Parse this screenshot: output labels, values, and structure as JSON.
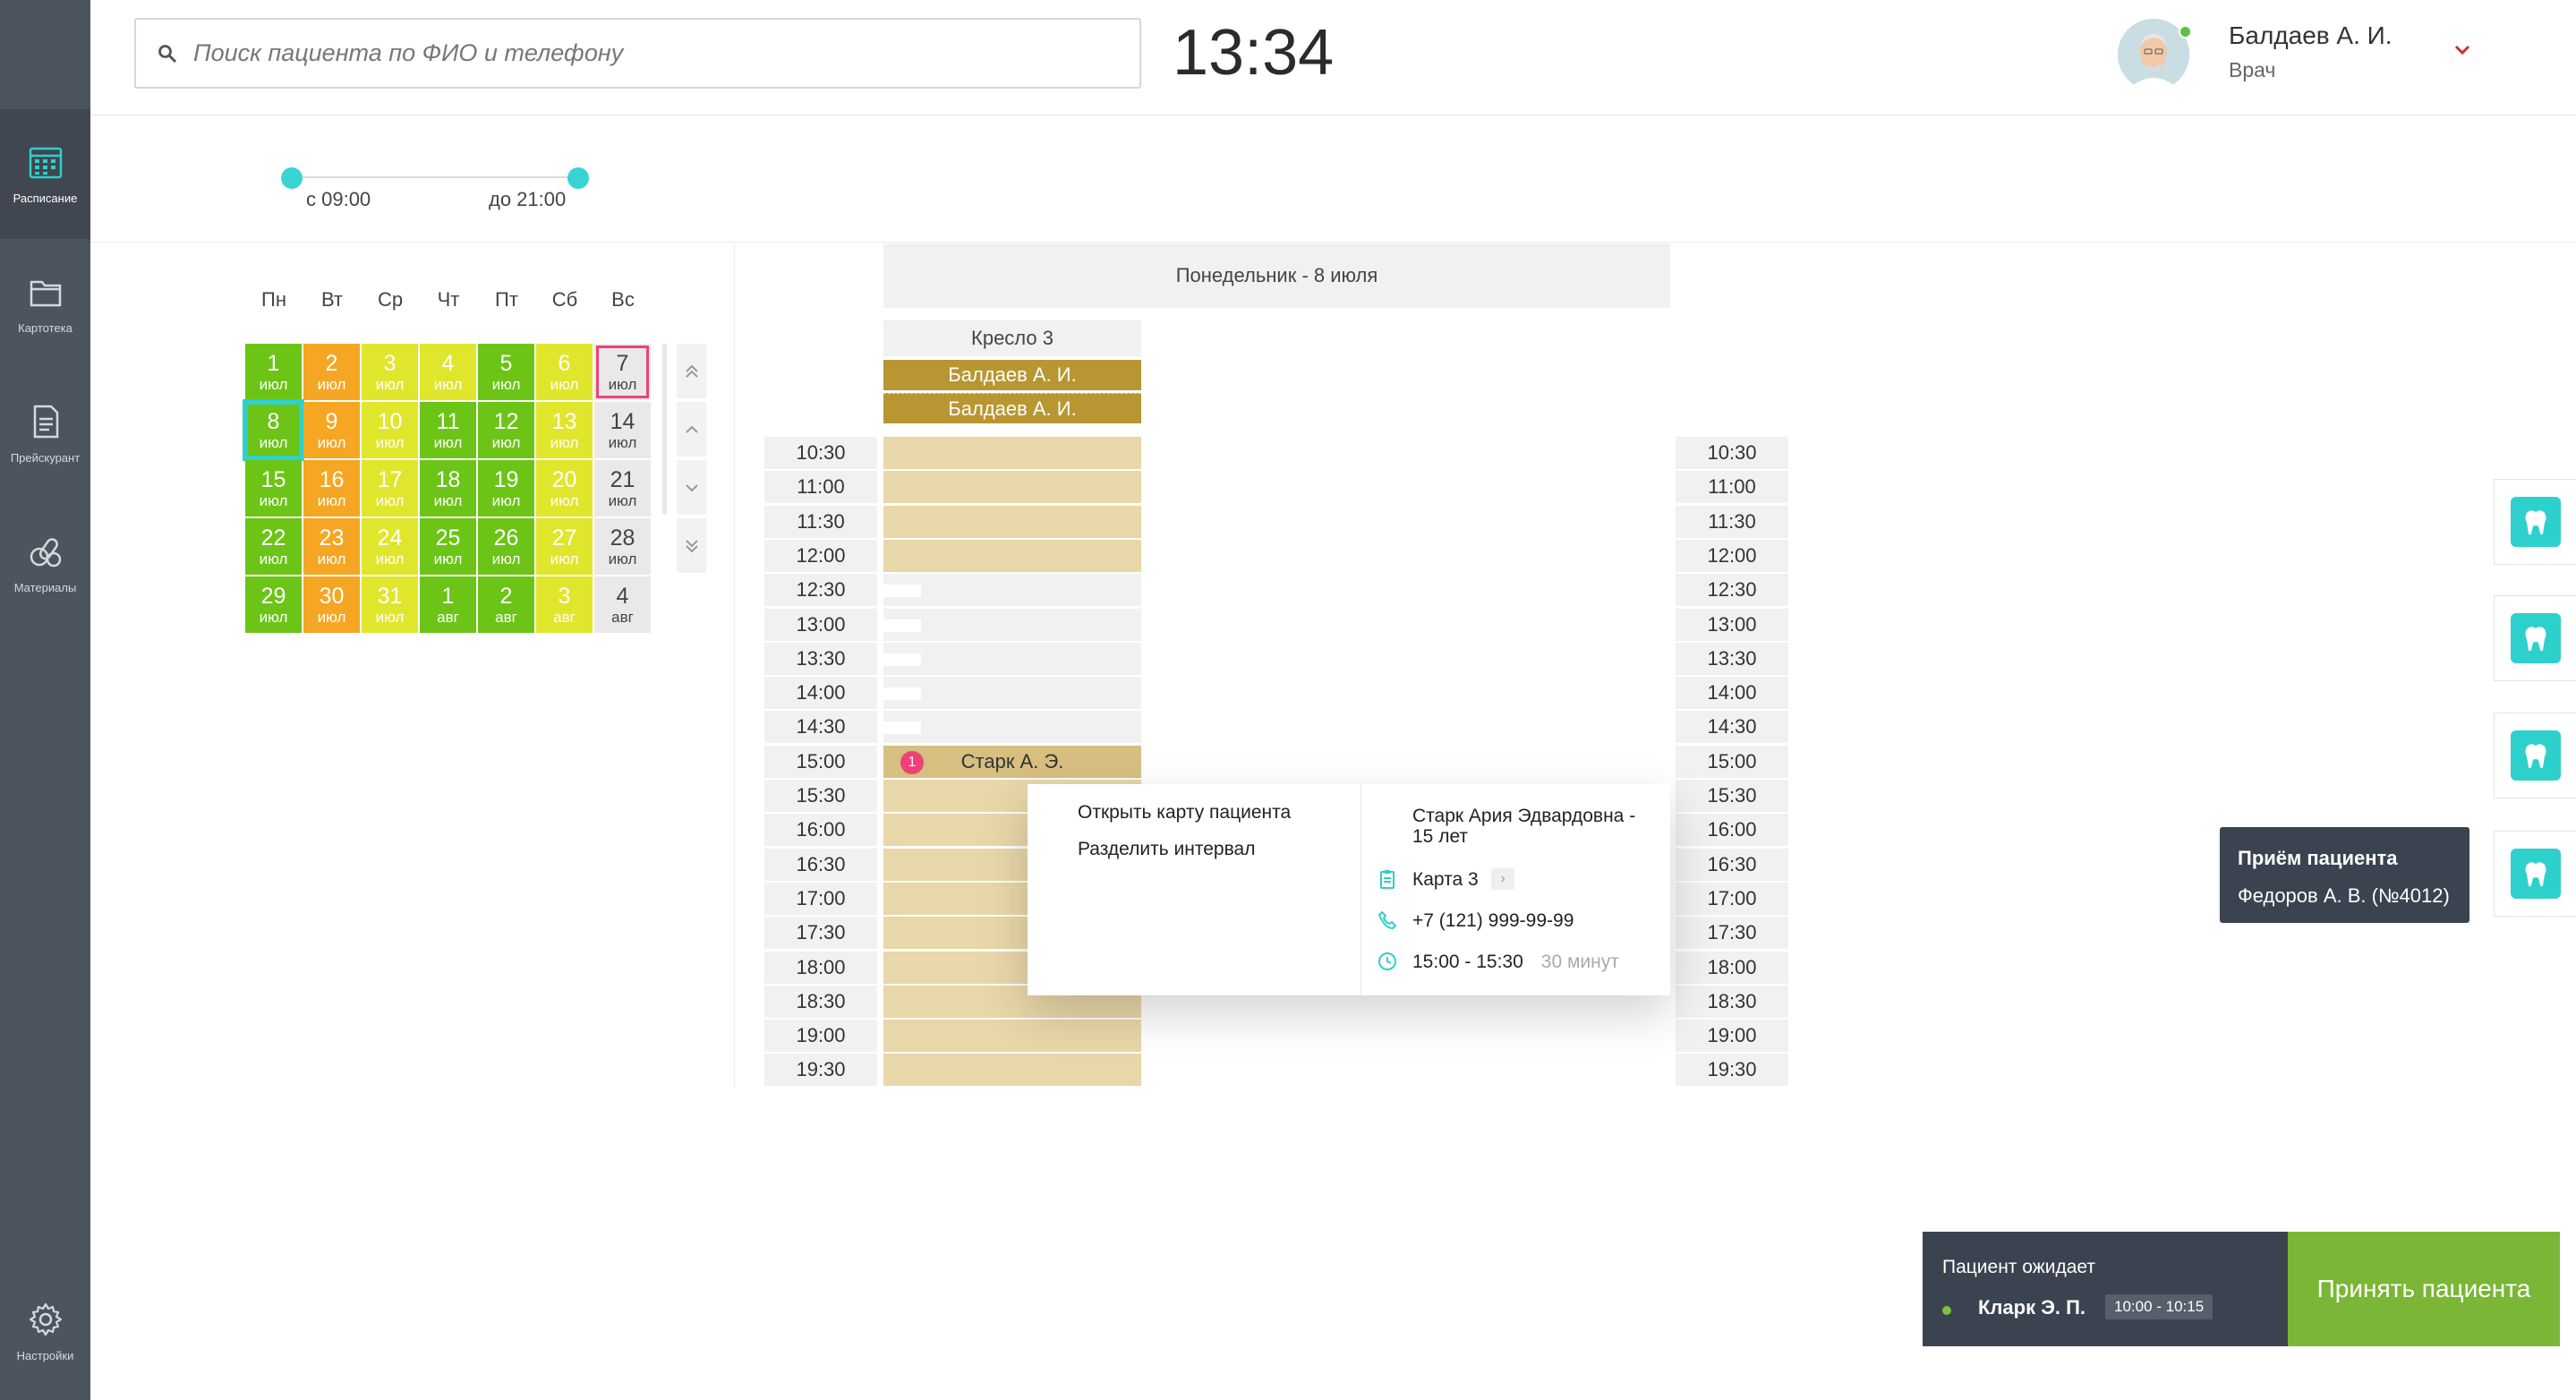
{
  "sidebar": {
    "items": [
      {
        "label": "Расписание",
        "icon": "calendar-icon"
      },
      {
        "label": "Картотека",
        "icon": "folder-icon"
      },
      {
        "label": "Прейскурант",
        "icon": "document-icon"
      },
      {
        "label": "Материалы",
        "icon": "pills-icon"
      }
    ],
    "settings_label": "Настройки"
  },
  "header": {
    "search_placeholder": "Поиск пациента по ФИО и телефону",
    "clock": "13:34",
    "user_name": "Балдаев А. И.",
    "user_role": "Врач"
  },
  "range": {
    "from_label": "с 09:00",
    "to_label": "до 21:00"
  },
  "calendar": {
    "weekdays": [
      "Пн",
      "Вт",
      "Ср",
      "Чт",
      "Пт",
      "Сб",
      "Вс"
    ],
    "weeks": [
      [
        {
          "n": "1",
          "m": "июл",
          "c": "green"
        },
        {
          "n": "2",
          "m": "июл",
          "c": "orange"
        },
        {
          "n": "3",
          "m": "июл",
          "c": "yellow"
        },
        {
          "n": "4",
          "m": "июл",
          "c": "yellow"
        },
        {
          "n": "5",
          "m": "июл",
          "c": "green"
        },
        {
          "n": "6",
          "m": "июл",
          "c": "yellow"
        },
        {
          "n": "7",
          "m": "июл",
          "c": "gray"
        }
      ],
      [
        {
          "n": "8",
          "m": "июл",
          "c": "green"
        },
        {
          "n": "9",
          "m": "июл",
          "c": "orange"
        },
        {
          "n": "10",
          "m": "июл",
          "c": "yellow"
        },
        {
          "n": "11",
          "m": "июл",
          "c": "green"
        },
        {
          "n": "12",
          "m": "июл",
          "c": "green"
        },
        {
          "n": "13",
          "m": "июл",
          "c": "yellow"
        },
        {
          "n": "14",
          "m": "июл",
          "c": "gray"
        }
      ],
      [
        {
          "n": "15",
          "m": "июл",
          "c": "green"
        },
        {
          "n": "16",
          "m": "июл",
          "c": "orange"
        },
        {
          "n": "17",
          "m": "июл",
          "c": "yellow"
        },
        {
          "n": "18",
          "m": "июл",
          "c": "green"
        },
        {
          "n": "19",
          "m": "июл",
          "c": "green"
        },
        {
          "n": "20",
          "m": "июл",
          "c": "yellow"
        },
        {
          "n": "21",
          "m": "июл",
          "c": "gray"
        }
      ],
      [
        {
          "n": "22",
          "m": "июл",
          "c": "green"
        },
        {
          "n": "23",
          "m": "июл",
          "c": "orange"
        },
        {
          "n": "24",
          "m": "июл",
          "c": "yellow"
        },
        {
          "n": "25",
          "m": "июл",
          "c": "green"
        },
        {
          "n": "26",
          "m": "июл",
          "c": "green"
        },
        {
          "n": "27",
          "m": "июл",
          "c": "yellow"
        },
        {
          "n": "28",
          "m": "июл",
          "c": "gray"
        }
      ],
      [
        {
          "n": "29",
          "m": "июл",
          "c": "green"
        },
        {
          "n": "30",
          "m": "июл",
          "c": "orange"
        },
        {
          "n": "31",
          "m": "июл",
          "c": "yellow"
        },
        {
          "n": "1",
          "m": "авг",
          "c": "green"
        },
        {
          "n": "2",
          "m": "авг",
          "c": "green"
        },
        {
          "n": "3",
          "m": "авг",
          "c": "yellow"
        },
        {
          "n": "4",
          "m": "авг",
          "c": "gray"
        }
      ]
    ],
    "colors": {
      "green": "#6cc417",
      "orange": "#f5a623",
      "yellow": "#e0e62c",
      "gray": "#e9e9e9",
      "selected_outline": "#2ed0cc",
      "today_marker": "#f0407a"
    }
  },
  "schedule": {
    "day_title": "Понедельник - 8 июля",
    "chair": "Кресло 3",
    "doctor_bands": [
      "Балдаев А. И.",
      "Балдаев А. И."
    ],
    "times": [
      "10:30",
      "11:00",
      "11:30",
      "12:00",
      "12:30",
      "13:00",
      "13:30",
      "14:00",
      "14:30",
      "15:00",
      "15:30",
      "16:00",
      "16:30",
      "17:00",
      "17:30",
      "18:00",
      "18:30",
      "19:00",
      "19:30"
    ],
    "slot_states": [
      "booked",
      "booked",
      "booked",
      "booked",
      "free",
      "free",
      "free",
      "free",
      "free",
      "patient",
      "booked",
      "booked",
      "booked",
      "booked",
      "booked",
      "booked",
      "booked",
      "booked",
      "booked"
    ],
    "appointment_patient": "Старк А. Э.",
    "appointment_badge": "1"
  },
  "popup": {
    "menu": [
      "Открыть карту пациента",
      "Разделить интервал"
    ],
    "patient_name": "Старк Ария Эдвардовна - 15 лет",
    "card": "Карта 3",
    "card_arrow": "›",
    "phone": "+7 (121) 999-99-99",
    "time_range": "15:00 - 15:30",
    "duration": "30 минут"
  },
  "tooltip": {
    "title": "Приём пациента",
    "body": "Федоров А. В. (№4012)"
  },
  "waiting": {
    "label": "Пациент ожидает",
    "patient": "Кларк Э. П.",
    "time": "10:00 - 10:15",
    "accept_label": "Принять пациента"
  }
}
